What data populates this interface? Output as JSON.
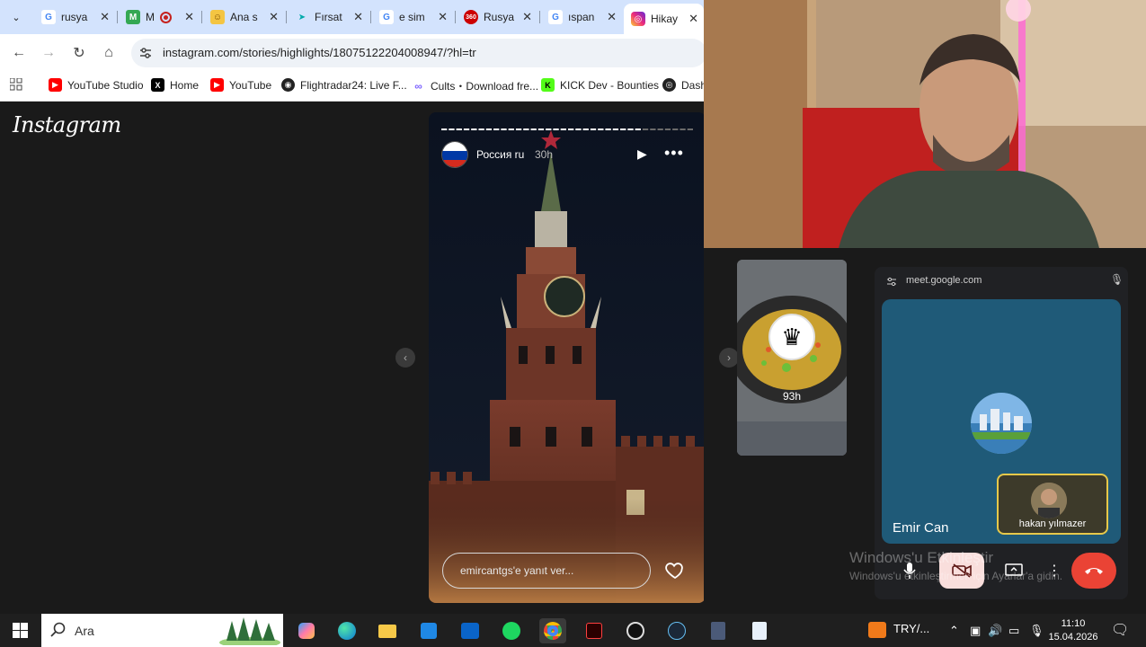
{
  "browser": {
    "tabs": [
      {
        "label": "rusya",
        "icon": "google-icon"
      },
      {
        "label": "M",
        "icon": "maps-icon"
      },
      {
        "label": "Ana s",
        "icon": "site-icon"
      },
      {
        "label": "Fırsat",
        "icon": "arrow-site-icon"
      },
      {
        "label": "e sim",
        "icon": "google-icon"
      },
      {
        "label": "Rusya",
        "icon": "360-icon"
      },
      {
        "label": "ıspan",
        "icon": "google-icon"
      },
      {
        "label": "Hikay",
        "icon": "instagram-icon"
      }
    ],
    "url": "instagram.com/stories/highlights/18075122204008947/?hl=tr",
    "bookmarks": [
      {
        "label": "YouTube Studio",
        "icon": "youtube-studio-icon",
        "color": "#ff0000"
      },
      {
        "label": "Home",
        "icon": "x-icon",
        "color": "#000000"
      },
      {
        "label": "YouTube",
        "icon": "youtube-icon",
        "color": "#ff0000"
      },
      {
        "label": "Flightradar24: Live F...",
        "icon": "flightradar-icon",
        "color": "#222222"
      },
      {
        "label": "Cults・Download fre...",
        "icon": "cults-icon",
        "color": "#7b61ff"
      },
      {
        "label": "KICK Dev - Bounties",
        "icon": "kick-icon",
        "color": "#53fc18"
      },
      {
        "label": "Dash",
        "icon": "dash-icon",
        "color": "#222222"
      }
    ]
  },
  "instagram": {
    "logo": "Instagram",
    "story": {
      "username": "Россия ru",
      "time": "30h",
      "reply_placeholder": "emircantgs'e yanıt ver..."
    },
    "next_story_time": "93h"
  },
  "meet": {
    "url": "meet.google.com",
    "participant_main": "Emir Can",
    "participant_pip": "hakan yılmazer"
  },
  "windows_watermark": {
    "title": "Windows'u Etkinleştir",
    "subtitle": "Windows'u etkinleştirmek için Ayarlar'a gidin."
  },
  "taskbar": {
    "search_label": "Ara",
    "currency": "TRY/...",
    "time": "11:10",
    "date": "15.04.2026"
  },
  "colors": {
    "instagram_bg": "#1a1a1a",
    "chrome_tabstrip": "#d3e3fd",
    "meet_tile": "#1f5a78",
    "end_call": "#ea4335"
  }
}
